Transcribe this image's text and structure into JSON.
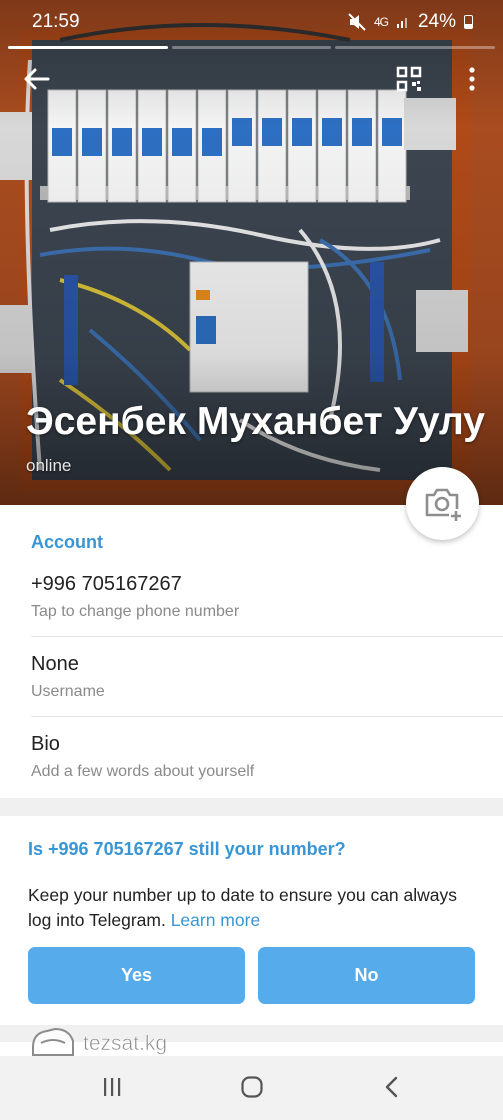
{
  "status_bar": {
    "time": "21:59",
    "signal": "4G",
    "battery": "24%"
  },
  "profile": {
    "name": "Эсенбек Муханбет Уулу",
    "status": "online"
  },
  "account": {
    "title": "Account",
    "phone": {
      "value": "+996 705167267",
      "hint": "Tap to change phone number"
    },
    "username": {
      "value": "None",
      "hint": "Username"
    },
    "bio": {
      "value": "Bio",
      "hint": "Add a few words about yourself"
    }
  },
  "number_check": {
    "title": "Is +996 705167267 still your number?",
    "text": "Keep your number up to date to ensure you can always log into Telegram.",
    "link": "Learn more",
    "yes_label": "Yes",
    "no_label": "No"
  },
  "watermark": "tezsat.kg",
  "colors": {
    "accent": "#3a95d4",
    "button": "#56abeb"
  },
  "icons": [
    "back-arrow-icon",
    "qr-code-icon",
    "more-vertical-icon",
    "camera-add-icon",
    "mute-icon",
    "recent-apps-icon",
    "home-icon",
    "nav-back-icon"
  ]
}
